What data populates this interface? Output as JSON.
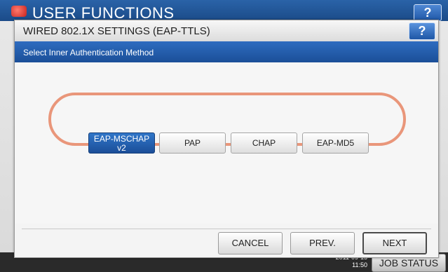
{
  "background": {
    "title": "USER FUNCTIONS",
    "help_label": "?",
    "clock_line1": "2011-09-15",
    "clock_line2": "11:50",
    "job_status_label": "JOB STATUS"
  },
  "dialog": {
    "title": "WIRED 802.1X SETTINGS (EAP-TTLS)",
    "help_label": "?",
    "instruction": "Select Inner Authentication Method",
    "methods": [
      {
        "label_line1": "EAP-MSCHAP",
        "label_line2": "v2",
        "selected": true
      },
      {
        "label": "PAP",
        "selected": false
      },
      {
        "label": "CHAP",
        "selected": false
      },
      {
        "label": "EAP-MD5",
        "selected": false
      }
    ],
    "footer": {
      "cancel_label": "CANCEL",
      "prev_label": "PREV.",
      "next_label": "NEXT"
    }
  },
  "colors": {
    "accent_blue": "#1b4f98",
    "highlight_ring": "#e9967a"
  }
}
